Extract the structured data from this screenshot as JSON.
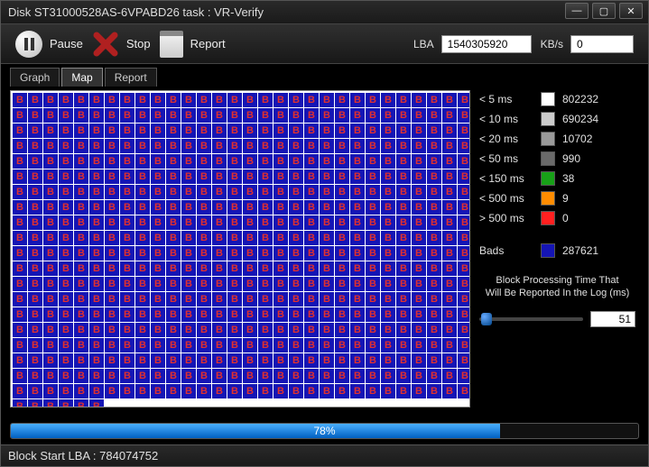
{
  "title": "Disk ST31000528AS-6VPABD26   task : VR-Verify",
  "toolbar": {
    "pause": "Pause",
    "stop": "Stop",
    "report": "Report",
    "lba_label": "LBA",
    "lba_value": "1540305920",
    "kbs_label": "KB/s",
    "kbs_value": "0"
  },
  "tabs": {
    "graph": "Graph",
    "map": "Map",
    "report": "Report",
    "active": "map"
  },
  "map": {
    "cols": 30,
    "full_rows": 20,
    "partial_row_cells": 6,
    "cell_glyph": "B",
    "cell_color": "#1515b5"
  },
  "legend": [
    {
      "label": "< 5 ms",
      "swatch": "#ffffff",
      "count": "802232"
    },
    {
      "label": "< 10 ms",
      "swatch": "#cccccc",
      "count": "690234"
    },
    {
      "label": "< 20 ms",
      "swatch": "#9a9a9a",
      "count": "10702"
    },
    {
      "label": "< 50 ms",
      "swatch": "#6a6a6a",
      "count": "990"
    },
    {
      "label": "< 150 ms",
      "swatch": "#18a018",
      "count": "38"
    },
    {
      "label": "< 500 ms",
      "swatch": "#ff8c00",
      "count": "9"
    },
    {
      "label": "> 500 ms",
      "swatch": "#ff2020",
      "count": "0"
    },
    {
      "label": "Bads",
      "swatch": "#1515b5",
      "count": "287621"
    }
  ],
  "slider": {
    "title_l1": "Block Processing Time That",
    "title_l2": "Will Be Reported In the Log (ms)",
    "value": "51"
  },
  "progress": {
    "percent": 78,
    "text": "78%"
  },
  "status": "Block Start LBA : 784074752"
}
